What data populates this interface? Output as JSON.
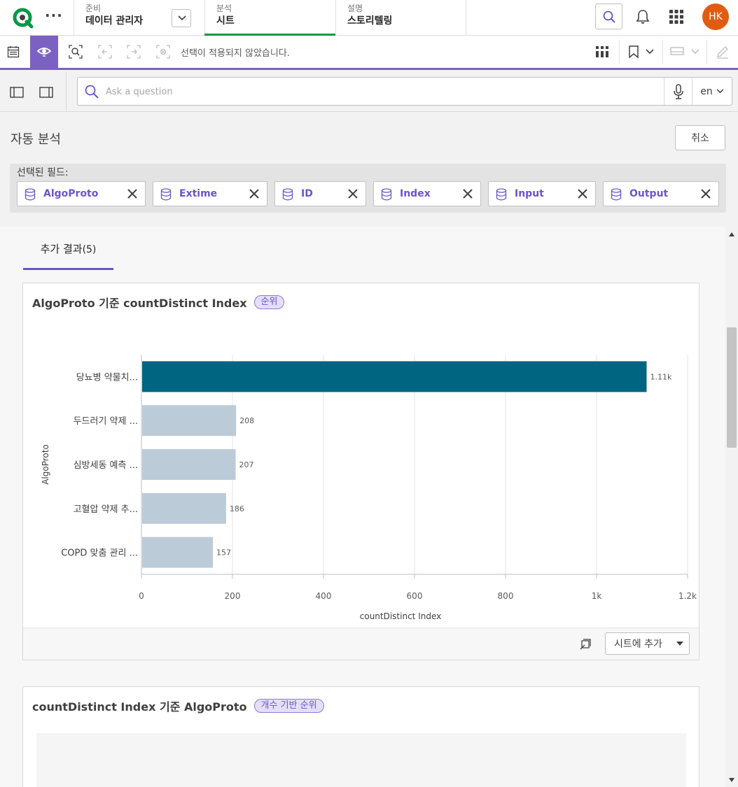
{
  "app": {
    "avatar_initials": "HK",
    "brand_color": "#009845",
    "accent_color": "#7b61c4"
  },
  "nav": {
    "prepare": {
      "sup": "준비",
      "main": "데이터 관리자"
    },
    "analyze": {
      "sup": "분석",
      "main": "시트"
    },
    "narrate": {
      "sup": "설명",
      "main": "스토리텔링"
    }
  },
  "toolbar": {
    "selection_text": "선택이 적용되지 않았습니다."
  },
  "question_bar": {
    "placeholder": "Ask a question",
    "language": "en"
  },
  "auto_analysis": {
    "title": "자동 분석",
    "cancel_label": "취소",
    "fields_label": "선택된 필드:",
    "fields": [
      "AlgoProto",
      "Extime",
      "ID",
      "Index",
      "Input",
      "Output"
    ]
  },
  "results": {
    "tab_label": "추가 결과",
    "tab_count": "(5)",
    "cards": [
      {
        "title": "AlgoProto 기준 countDistinct Index",
        "badge": "순위",
        "add_label": "시트에 추가"
      },
      {
        "title": "countDistinct Index 기준 AlgoProto",
        "badge": "개수 기반 순위"
      }
    ]
  },
  "chart_data": {
    "type": "bar",
    "orientation": "horizontal",
    "categories": [
      "당뇨병 약물치...",
      "두드러기 약제 ...",
      "심방세동 예측 ...",
      "고혈압 약제 추...",
      "COPD 맞춤 관리 ..."
    ],
    "values": [
      1110,
      208,
      207,
      186,
      157
    ],
    "data_labels": [
      "1.11k",
      "208",
      "207",
      "186",
      "157"
    ],
    "xlabel": "countDistinct Index",
    "ylabel": "AlgoProto",
    "xlim": [
      0,
      1200
    ],
    "x_ticks": [
      0,
      200,
      400,
      600,
      800,
      1000,
      1200
    ],
    "x_tick_labels": [
      "0",
      "200",
      "400",
      "600",
      "800",
      "1k",
      "1.2k"
    ],
    "highlight_color": "#006580",
    "bar_color": "#bccbd8",
    "grid": true
  }
}
